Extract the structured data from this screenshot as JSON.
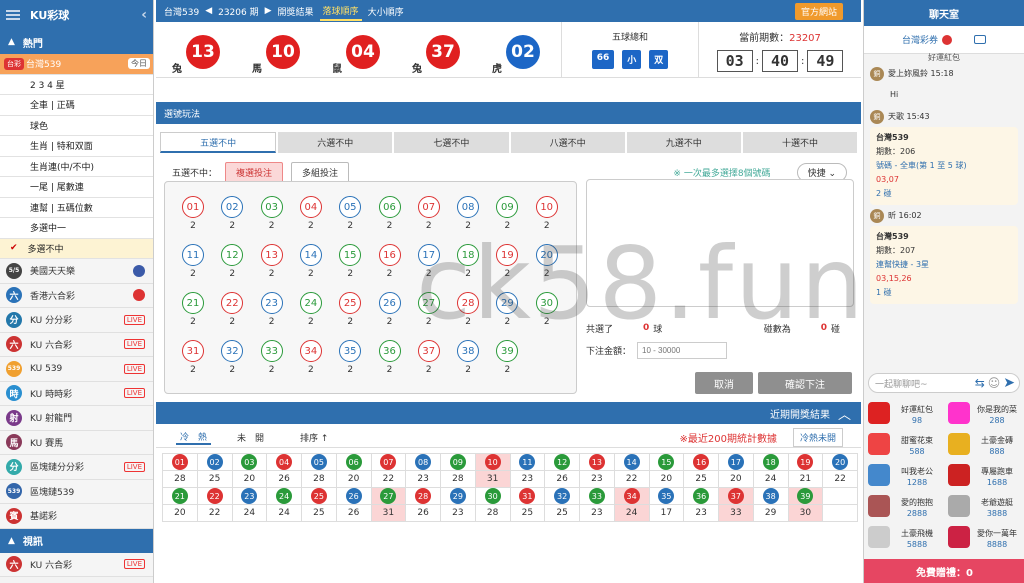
{
  "sidebar": {
    "brand": "KU彩球",
    "hot_label": "熱門",
    "active_lottery": {
      "logo": "台彩",
      "label": "台灣539",
      "tag": "今日"
    },
    "sub_items": [
      "2 3 4 星",
      "全車 | 正碼",
      "球色",
      "生肖 | 特和双面",
      "生肖連(中/不中)",
      "一尾 | 尾數連",
      "連幫 | 五碼位數",
      "多選中一",
      "多選不中"
    ],
    "lotteries": [
      {
        "icon": "5/5",
        "label": "美國天天樂",
        "color": "#444",
        "extra": "flag-us"
      },
      {
        "icon": "六",
        "label": "香港六合彩",
        "color": "#2a72b8",
        "extra": "flag-hk"
      },
      {
        "icon": "分",
        "label": "KU 分分彩",
        "color": "#27a",
        "extra": "LIVE"
      },
      {
        "icon": "六",
        "label": "KU 六合彩",
        "color": "#c33",
        "extra": "LIVE"
      },
      {
        "icon": "539",
        "label": "KU 539",
        "color": "#f0a030",
        "extra": "LIVE"
      },
      {
        "icon": "時",
        "label": "KU 時時彩",
        "color": "#2a8fd0",
        "extra": "LIVE"
      },
      {
        "icon": "射",
        "label": "KU 射龍門",
        "color": "#7a3a8a",
        "extra": ""
      },
      {
        "icon": "馬",
        "label": "KU 賽馬",
        "color": "#8a3a5a",
        "extra": ""
      },
      {
        "icon": "分",
        "label": "區塊鏈分分彩",
        "color": "#3aa",
        "extra": "LIVE"
      },
      {
        "icon": "539",
        "label": "區塊鏈539",
        "color": "#36a",
        "extra": ""
      },
      {
        "icon": "賓",
        "label": "基諾彩",
        "color": "#c33",
        "extra": ""
      }
    ],
    "video_label": "視訊",
    "video_item": {
      "icon": "六",
      "label": "KU 六合彩",
      "extra": "LIVE"
    }
  },
  "topbar": {
    "lottery": "台灣539",
    "period_nav": "23206 期",
    "results_label": "開獎結果",
    "drop_order": "落球順序",
    "size_order": "大小順序",
    "official_site": "官方網站"
  },
  "draw": {
    "balls": [
      {
        "num": "13",
        "zodiac": "兔",
        "color": "#e02020"
      },
      {
        "num": "10",
        "zodiac": "馬",
        "color": "#e02020"
      },
      {
        "num": "04",
        "zodiac": "鼠",
        "color": "#e02020"
      },
      {
        "num": "37",
        "zodiac": "兔",
        "color": "#e02020"
      },
      {
        "num": "02",
        "zodiac": "虎",
        "color": "#1c66c6"
      }
    ],
    "sum_label": "五球總和",
    "sum": "66",
    "size": "小",
    "parity": "双",
    "period_label": "當前期數：",
    "period": "23207",
    "countdown": [
      "03",
      "40",
      "49"
    ]
  },
  "play": {
    "header": "選號玩法",
    "tabs": [
      "五選不中",
      "六選不中",
      "七選不中",
      "八選不中",
      "九選不中",
      "十選不中"
    ],
    "mode_label": "五選不中：",
    "mode_single": "複選投注",
    "mode_multi": "多組投注",
    "note": "※ 一次最多選擇8個號碼",
    "quick": "快捷",
    "numbers": [
      {
        "n": "01",
        "c": "2",
        "color": "#d33"
      },
      {
        "n": "02",
        "c": "2",
        "color": "#2a72b8"
      },
      {
        "n": "03",
        "c": "2",
        "color": "#2a9a3a"
      },
      {
        "n": "04",
        "c": "2",
        "color": "#d33"
      },
      {
        "n": "05",
        "c": "2",
        "color": "#2a72b8"
      },
      {
        "n": "06",
        "c": "2",
        "color": "#2a9a3a"
      },
      {
        "n": "07",
        "c": "2",
        "color": "#d33"
      },
      {
        "n": "08",
        "c": "2",
        "color": "#2a72b8"
      },
      {
        "n": "09",
        "c": "2",
        "color": "#2a9a3a"
      },
      {
        "n": "10",
        "c": "2",
        "color": "#d33"
      },
      {
        "n": "11",
        "c": "2",
        "color": "#2a72b8"
      },
      {
        "n": "12",
        "c": "2",
        "color": "#2a9a3a"
      },
      {
        "n": "13",
        "c": "2",
        "color": "#d33"
      },
      {
        "n": "14",
        "c": "2",
        "color": "#2a72b8"
      },
      {
        "n": "15",
        "c": "2",
        "color": "#2a9a3a"
      },
      {
        "n": "16",
        "c": "2",
        "color": "#d33"
      },
      {
        "n": "17",
        "c": "2",
        "color": "#2a72b8"
      },
      {
        "n": "18",
        "c": "2",
        "color": "#2a9a3a"
      },
      {
        "n": "19",
        "c": "2",
        "color": "#d33"
      },
      {
        "n": "20",
        "c": "2",
        "color": "#2a72b8"
      },
      {
        "n": "21",
        "c": "2",
        "color": "#2a9a3a"
      },
      {
        "n": "22",
        "c": "2",
        "color": "#d33"
      },
      {
        "n": "23",
        "c": "2",
        "color": "#2a72b8"
      },
      {
        "n": "24",
        "c": "2",
        "color": "#2a9a3a"
      },
      {
        "n": "25",
        "c": "2",
        "color": "#d33"
      },
      {
        "n": "26",
        "c": "2",
        "color": "#2a72b8"
      },
      {
        "n": "27",
        "c": "2",
        "color": "#2a9a3a"
      },
      {
        "n": "28",
        "c": "2",
        "color": "#d33"
      },
      {
        "n": "29",
        "c": "2",
        "color": "#2a72b8"
      },
      {
        "n": "30",
        "c": "2",
        "color": "#2a9a3a"
      },
      {
        "n": "31",
        "c": "2",
        "color": "#d33"
      },
      {
        "n": "32",
        "c": "2",
        "color": "#2a72b8"
      },
      {
        "n": "33",
        "c": "2",
        "color": "#2a9a3a"
      },
      {
        "n": "34",
        "c": "2",
        "color": "#d33"
      },
      {
        "n": "35",
        "c": "2",
        "color": "#2a72b8"
      },
      {
        "n": "36",
        "c": "2",
        "color": "#2a9a3a"
      },
      {
        "n": "37",
        "c": "2",
        "color": "#d33"
      },
      {
        "n": "38",
        "c": "2",
        "color": "#2a72b8"
      },
      {
        "n": "39",
        "c": "2",
        "color": "#2a9a3a"
      }
    ],
    "selected_label": "共選了",
    "selected_count": "0",
    "selected_unit": "球",
    "combos_label": "碰數為",
    "combos_count": "0",
    "combos_unit": "碰",
    "amount_label": "下注金額：",
    "amount_placeholder": "10 - 30000",
    "cancel": "取消",
    "confirm": "確認下注"
  },
  "recent": {
    "title": "近期開獎結果",
    "tab_hot": "冷　熱",
    "tab_missing": "未　開",
    "sort": "排序",
    "stat_note": "※最近200期統計數據",
    "cold_hot": "冷熱未開",
    "row1": [
      {
        "n": "01",
        "v": "28",
        "color": "#d33"
      },
      {
        "n": "02",
        "v": "25",
        "color": "#2a72b8"
      },
      {
        "n": "03",
        "v": "20",
        "color": "#2a9a3a"
      },
      {
        "n": "04",
        "v": "26",
        "color": "#d33"
      },
      {
        "n": "05",
        "v": "28",
        "color": "#2a72b8"
      },
      {
        "n": "06",
        "v": "20",
        "color": "#2a9a3a"
      },
      {
        "n": "07",
        "v": "22",
        "color": "#d33"
      },
      {
        "n": "08",
        "v": "23",
        "color": "#2a72b8"
      },
      {
        "n": "09",
        "v": "28",
        "color": "#2a9a3a"
      },
      {
        "n": "10",
        "v": "31",
        "color": "#d33",
        "hl": true
      },
      {
        "n": "11",
        "v": "23",
        "color": "#2a72b8"
      },
      {
        "n": "12",
        "v": "26",
        "color": "#2a9a3a"
      },
      {
        "n": "13",
        "v": "23",
        "color": "#d33"
      },
      {
        "n": "14",
        "v": "22",
        "color": "#2a72b8"
      },
      {
        "n": "15",
        "v": "20",
        "color": "#2a9a3a"
      },
      {
        "n": "16",
        "v": "25",
        "color": "#d33"
      },
      {
        "n": "17",
        "v": "20",
        "color": "#2a72b8"
      },
      {
        "n": "18",
        "v": "24",
        "color": "#2a9a3a"
      },
      {
        "n": "19",
        "v": "21",
        "color": "#d33"
      },
      {
        "n": "20",
        "v": "22",
        "color": "#2a72b8"
      }
    ],
    "row2": [
      {
        "n": "21",
        "v": "20",
        "color": "#2a9a3a"
      },
      {
        "n": "22",
        "v": "22",
        "color": "#d33"
      },
      {
        "n": "23",
        "v": "24",
        "color": "#2a72b8"
      },
      {
        "n": "24",
        "v": "24",
        "color": "#2a9a3a"
      },
      {
        "n": "25",
        "v": "25",
        "color": "#d33"
      },
      {
        "n": "26",
        "v": "26",
        "color": "#2a72b8"
      },
      {
        "n": "27",
        "v": "31",
        "color": "#2a9a3a",
        "hl": true
      },
      {
        "n": "28",
        "v": "26",
        "color": "#d33"
      },
      {
        "n": "29",
        "v": "23",
        "color": "#2a72b8"
      },
      {
        "n": "30",
        "v": "28",
        "color": "#2a9a3a"
      },
      {
        "n": "31",
        "v": "25",
        "color": "#d33"
      },
      {
        "n": "32",
        "v": "25",
        "color": "#2a72b8"
      },
      {
        "n": "33",
        "v": "23",
        "color": "#2a9a3a"
      },
      {
        "n": "34",
        "v": "24",
        "color": "#d33",
        "hl": true
      },
      {
        "n": "35",
        "v": "17",
        "color": "#2a72b8"
      },
      {
        "n": "36",
        "v": "23",
        "color": "#2a9a3a"
      },
      {
        "n": "37",
        "v": "33",
        "color": "#d33",
        "hl": true
      },
      {
        "n": "38",
        "v": "29",
        "color": "#2a72b8"
      },
      {
        "n": "39",
        "v": "30",
        "color": "#2a9a3a",
        "hl": true
      }
    ]
  },
  "chat": {
    "title": "聊天室",
    "room": "台灣彩券",
    "pinned": "好運紅包",
    "messages": [
      {
        "user": "愛上妳風鈴 15:18",
        "text": "Hi"
      },
      {
        "user": "天歌 15:43",
        "lottery": "台灣539",
        "period": "期數：206",
        "type": "號碼 - 全車(第 1 至 5 球)",
        "nums": "03,07",
        "combos": "2 碰"
      },
      {
        "user": "昕 16:02",
        "lottery": "台灣539",
        "period": "期數：207",
        "type": "連幫快捷 - 3星",
        "nums": "03,15,26",
        "combos": "1 碰"
      }
    ],
    "input_placeholder": "一起聊聊吧~",
    "gifts": [
      {
        "name": "好運紅包",
        "price": "98",
        "color": "#d22"
      },
      {
        "name": "你是我的菜",
        "price": "288",
        "color": "#f3c"
      },
      {
        "name": "甜蜜花束",
        "price": "588",
        "color": "#e44"
      },
      {
        "name": "土豪金磚",
        "price": "888",
        "color": "#e8b020"
      },
      {
        "name": "叫我老公",
        "price": "1288",
        "color": "#48c"
      },
      {
        "name": "專屬跑車",
        "price": "1688",
        "color": "#c22"
      },
      {
        "name": "愛的抱抱",
        "price": "2888",
        "color": "#a55"
      },
      {
        "name": "老爺遊艇",
        "price": "3888",
        "color": "#aaa"
      },
      {
        "name": "土豪飛機",
        "price": "5888",
        "color": "#ccc"
      },
      {
        "name": "愛你一萬年",
        "price": "8888",
        "color": "#c24"
      }
    ],
    "free_gift": "免費贈禮：0"
  },
  "watermark": "ck58.fun"
}
